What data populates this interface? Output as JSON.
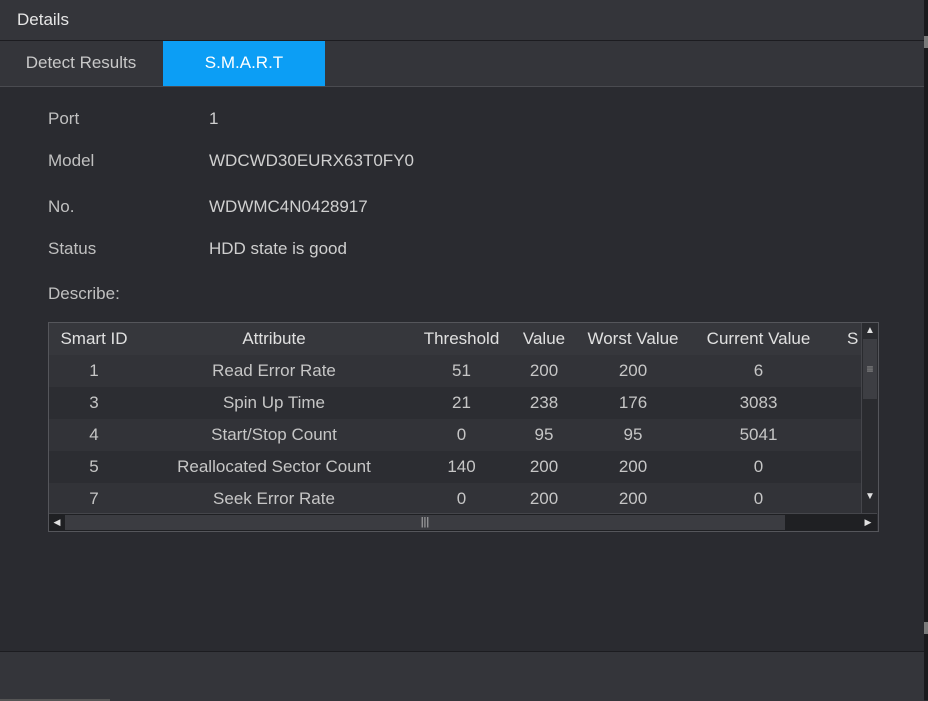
{
  "window": {
    "title": "Details"
  },
  "tabs": [
    {
      "label": "Detect Results",
      "active": false
    },
    {
      "label": "S.M.A.R.T",
      "active": true
    }
  ],
  "accent_color": "#0c9ef5",
  "fields": {
    "port": {
      "label": "Port",
      "value": "1"
    },
    "model": {
      "label": "Model",
      "value": "WDCWD30EURX63T0FY0"
    },
    "no": {
      "label": "No.",
      "value": "WDWMC4N0428917"
    },
    "status": {
      "label": "Status",
      "value": "HDD state is good"
    },
    "describe": {
      "label": "Describe:"
    }
  },
  "table": {
    "columns": [
      "Smart ID",
      "Attribute",
      "Threshold",
      "Value",
      "Worst Value",
      "Current Value",
      "S"
    ],
    "rows": [
      {
        "id": "1",
        "attribute": "Read Error Rate",
        "threshold": "51",
        "value": "200",
        "worst": "200",
        "current": "6"
      },
      {
        "id": "3",
        "attribute": "Spin Up Time",
        "threshold": "21",
        "value": "238",
        "worst": "176",
        "current": "3083"
      },
      {
        "id": "4",
        "attribute": "Start/Stop Count",
        "threshold": "0",
        "value": "95",
        "worst": "95",
        "current": "5041"
      },
      {
        "id": "5",
        "attribute": "Reallocated Sector Count",
        "threshold": "140",
        "value": "200",
        "worst": "200",
        "current": "0"
      },
      {
        "id": "7",
        "attribute": "Seek Error Rate",
        "threshold": "0",
        "value": "200",
        "worst": "200",
        "current": "0"
      }
    ]
  },
  "scrollbars": {
    "vertical": {
      "up": "▲",
      "down": "▼",
      "thumb_grip": "≡"
    },
    "horizontal": {
      "left": "◀",
      "right": "▶",
      "thumb_grip": "|||"
    }
  }
}
